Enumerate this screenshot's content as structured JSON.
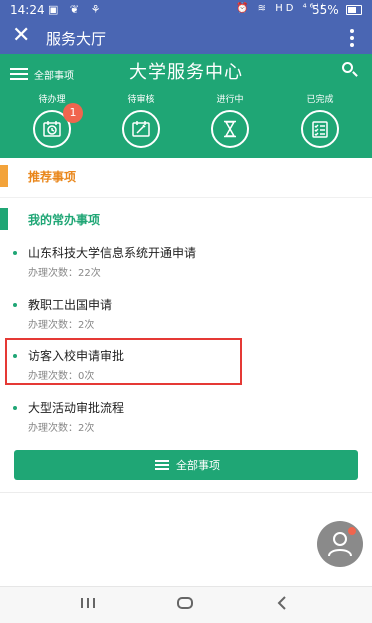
{
  "status_bar": {
    "time": "14:24",
    "left_icons": "▣ ❦ ⚘",
    "right_icons": "⏰ ≋ HD ⁴⁶ᴵᴵ",
    "battery": "55%"
  },
  "titlebar": {
    "close_glyph": "✕",
    "title": "服务大厅"
  },
  "hero": {
    "menu_label": "全部事项",
    "title": "大学服务中心",
    "statuses": [
      {
        "label": "待办理",
        "icon": "clock-calendar-icon",
        "badge": "1"
      },
      {
        "label": "待审核",
        "icon": "edit-calendar-icon"
      },
      {
        "label": "进行中",
        "icon": "hourglass-icon"
      },
      {
        "label": "已完成",
        "icon": "checklist-icon"
      }
    ]
  },
  "sections": {
    "recommended": "推荐事项",
    "frequent": "我的常办事项"
  },
  "items": [
    {
      "name": "山东科技大学信息系统开通申请",
      "count": "办理次数：22次"
    },
    {
      "name": "教职工出国申请",
      "count": "办理次数：2次"
    },
    {
      "name": "访客入校申请审批",
      "count": "办理次数：0次"
    },
    {
      "name": "大型活动审批流程",
      "count": "办理次数：2次"
    }
  ],
  "all_button": {
    "label": "全部事项"
  },
  "colors": {
    "header_blue": "#4a66b3",
    "brand_green": "#1fa675",
    "accent_orange": "#f3a33a",
    "badge_red": "#f0654e",
    "highlight_red": "#e53935"
  }
}
